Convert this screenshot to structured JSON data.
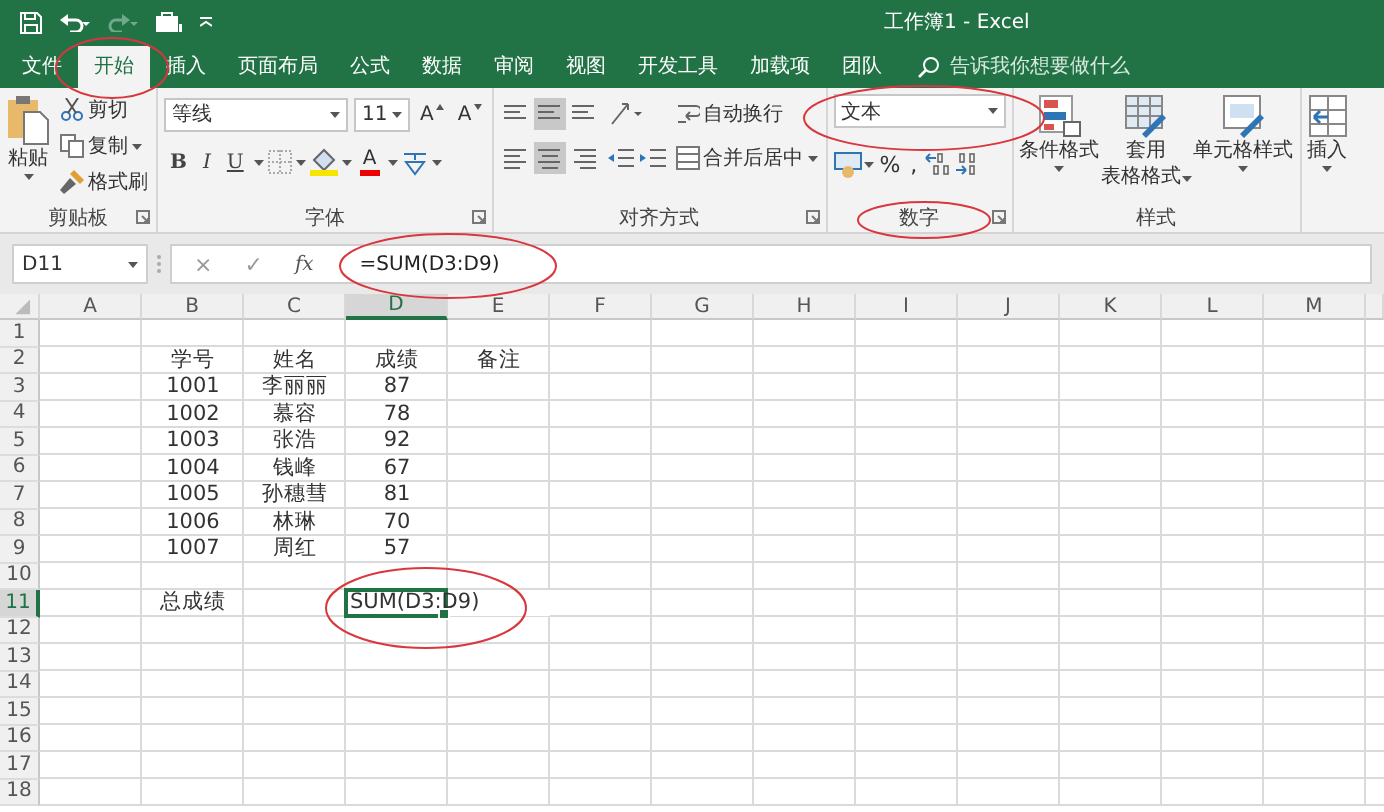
{
  "title_bar": {
    "title": "工作簿1 - Excel"
  },
  "tabs": [
    {
      "label": "文件",
      "selected": false
    },
    {
      "label": "开始",
      "selected": true
    },
    {
      "label": "插入",
      "selected": false
    },
    {
      "label": "页面布局",
      "selected": false
    },
    {
      "label": "公式",
      "selected": false
    },
    {
      "label": "数据",
      "selected": false
    },
    {
      "label": "审阅",
      "selected": false
    },
    {
      "label": "视图",
      "selected": false
    },
    {
      "label": "开发工具",
      "selected": false
    },
    {
      "label": "加载项",
      "selected": false
    },
    {
      "label": "团队",
      "selected": false
    }
  ],
  "search": {
    "placeholder": "告诉我你想要做什么"
  },
  "ribbon": {
    "clipboard": {
      "label": "剪贴板",
      "paste": "粘贴",
      "items": [
        "剪切",
        "复制",
        "格式刷"
      ]
    },
    "font": {
      "label": "字体",
      "font_name": "等线",
      "font_size": "11",
      "size_buttons": [
        "A",
        "A"
      ],
      "format_buttons": [
        "B",
        "I",
        "U"
      ],
      "font_color": "A"
    },
    "alignment": {
      "label": "对齐方式",
      "wrap": "自动换行",
      "merge": "合并后居中"
    },
    "number": {
      "label": "数字",
      "format": "文本",
      "percent": "%",
      "comma": ","
    },
    "styles": {
      "label": "样式",
      "items": [
        {
          "lines": [
            "条件格式"
          ]
        },
        {
          "lines": [
            "套用",
            "表格格式"
          ]
        },
        {
          "lines": [
            "单元格样式"
          ]
        }
      ]
    },
    "cells": {
      "insert": "插入"
    }
  },
  "formula_bar": {
    "name_box": "D11",
    "buttons": [
      "×",
      "✓",
      "fx"
    ],
    "formula": "=SUM(D3:D9)"
  },
  "sheet": {
    "columns": [
      {
        "label": "A",
        "selected": false
      },
      {
        "label": "B",
        "selected": false
      },
      {
        "label": "C",
        "selected": false
      },
      {
        "label": "D",
        "selected": true
      },
      {
        "label": "E",
        "selected": false
      },
      {
        "label": "F",
        "selected": false
      },
      {
        "label": "G",
        "selected": false
      },
      {
        "label": "H",
        "selected": false
      },
      {
        "label": "I",
        "selected": false
      },
      {
        "label": "J",
        "selected": false
      },
      {
        "label": "K",
        "selected": false
      },
      {
        "label": "L",
        "selected": false
      },
      {
        "label": "M",
        "selected": false
      }
    ],
    "rows": [
      {
        "number": "1",
        "selected": false
      },
      {
        "number": "2",
        "selected": false,
        "cells": {
          "B": "学号",
          "C": "姓名",
          "D": "成绩",
          "E": "备注"
        }
      },
      {
        "number": "3",
        "selected": false,
        "cells": {
          "B": "1001",
          "C": "李丽丽",
          "D": "87"
        }
      },
      {
        "number": "4",
        "selected": false,
        "cells": {
          "B": "1002",
          "C": "慕容",
          "D": "78"
        }
      },
      {
        "number": "5",
        "selected": false,
        "cells": {
          "B": "1003",
          "C": "张浩",
          "D": "92"
        }
      },
      {
        "number": "6",
        "selected": false,
        "cells": {
          "B": "1004",
          "C": "钱峰",
          "D": "67"
        }
      },
      {
        "number": "7",
        "selected": false,
        "cells": {
          "B": "1005",
          "C": "孙穗彗",
          "D": "81"
        }
      },
      {
        "number": "8",
        "selected": false,
        "cells": {
          "B": "1006",
          "C": "林琳",
          "D": "70"
        }
      },
      {
        "number": "9",
        "selected": false,
        "cells": {
          "B": "1007",
          "C": "周红",
          "D": "57"
        }
      },
      {
        "number": "10",
        "selected": false
      },
      {
        "number": "11",
        "selected": true,
        "cells": {
          "B": "总成绩",
          "D": "SUM(D3:D9)"
        }
      },
      {
        "number": "12",
        "selected": false
      },
      {
        "number": "13",
        "selected": false
      },
      {
        "number": "14",
        "selected": false
      },
      {
        "number": "15",
        "selected": false
      },
      {
        "number": "16",
        "selected": false
      },
      {
        "number": "17",
        "selected": false
      },
      {
        "number": "18",
        "selected": false
      }
    ]
  }
}
